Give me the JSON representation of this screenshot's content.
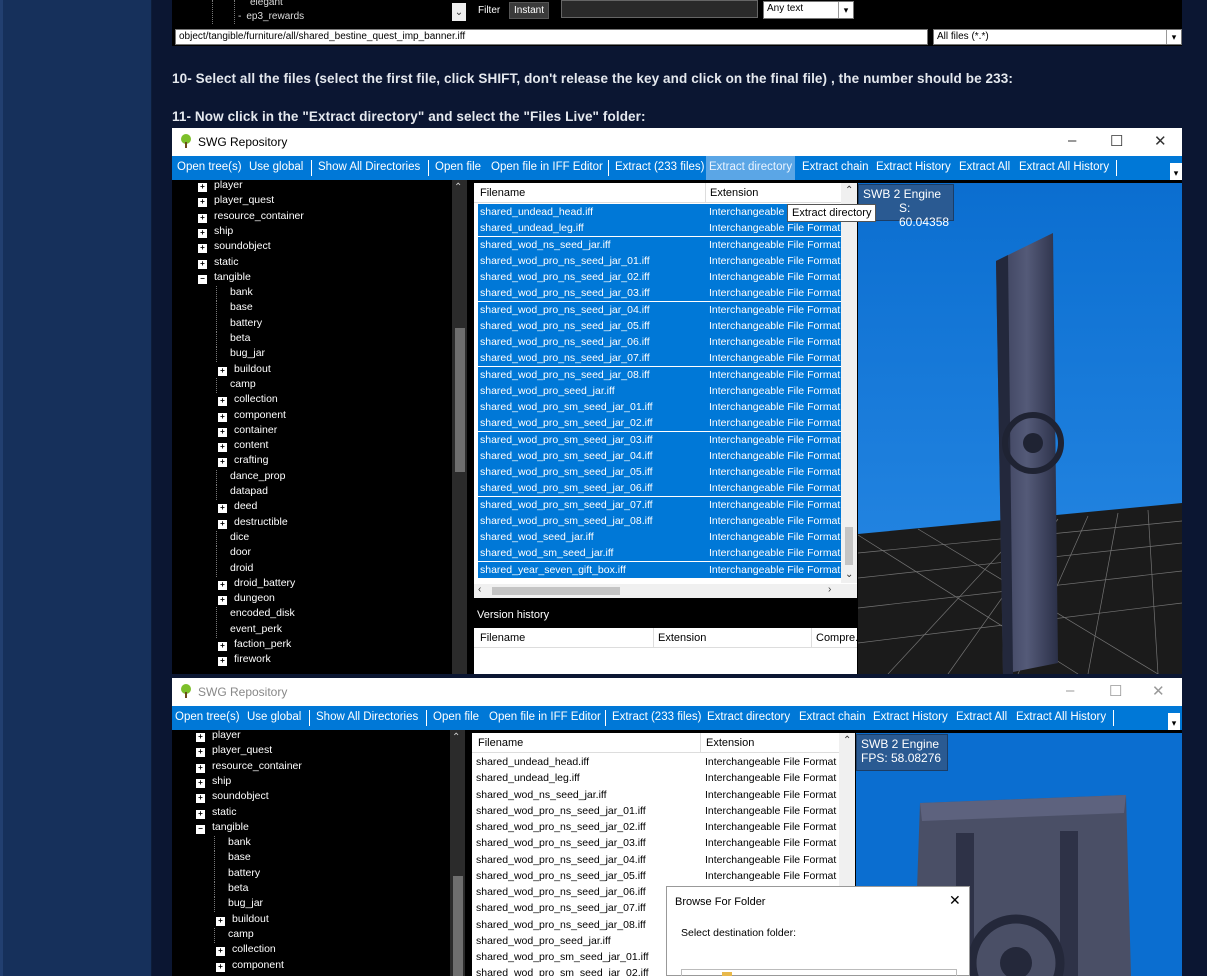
{
  "strip": {
    "tree_rows": [
      "elegant",
      "ep3_rewards"
    ],
    "filter_label": "Filter",
    "instant_button": "Instant",
    "any_text": "Any text",
    "path": "object/tangible/furniture/all/shared_bestine_quest_imp_banner.iff",
    "file_type": "All files (*.*)"
  },
  "instructions": {
    "step10": "10- Select all the files (select the first file, click SHIFT, don't release the key and click on the final file) , the number should be 233:",
    "step11": "11- Now click in the \"Extract directory\" and select the \"Files Live\" folder:"
  },
  "window": {
    "title": "SWG Repository",
    "minimize": "–",
    "maximize": "☐",
    "close": "✕"
  },
  "menu": {
    "open_tree": "Open tree(s)",
    "use_global": "Use global",
    "show_all_dirs": "Show All Directories",
    "open_file": "Open file",
    "open_file_iff": "Open file in IFF Editor",
    "extract": "Extract (233 files)",
    "extract_dir": "Extract directory",
    "extract_chain": "Extract chain",
    "extract_history": "Extract History",
    "extract_all": "Extract All",
    "extract_all_history": "Extract All History",
    "dropdown": "▾"
  },
  "tree1": [
    {
      "label": "player",
      "exp": "+"
    },
    {
      "label": "player_quest",
      "exp": "+"
    },
    {
      "label": "resource_container",
      "exp": "+"
    },
    {
      "label": "ship",
      "exp": "+"
    },
    {
      "label": "soundobject",
      "exp": "+"
    },
    {
      "label": "static",
      "exp": "+"
    },
    {
      "label": "tangible",
      "exp": "−"
    },
    {
      "label": "bank",
      "exp": ""
    },
    {
      "label": "base",
      "exp": ""
    },
    {
      "label": "battery",
      "exp": ""
    },
    {
      "label": "beta",
      "exp": ""
    },
    {
      "label": "bug_jar",
      "exp": ""
    },
    {
      "label": "buildout",
      "exp": "+"
    },
    {
      "label": "camp",
      "exp": ""
    },
    {
      "label": "collection",
      "exp": "+"
    },
    {
      "label": "component",
      "exp": "+"
    },
    {
      "label": "container",
      "exp": "+"
    },
    {
      "label": "content",
      "exp": "+"
    },
    {
      "label": "crafting",
      "exp": "+"
    },
    {
      "label": "dance_prop",
      "exp": ""
    },
    {
      "label": "datapad",
      "exp": ""
    },
    {
      "label": "deed",
      "exp": "+"
    },
    {
      "label": "destructible",
      "exp": "+"
    },
    {
      "label": "dice",
      "exp": ""
    },
    {
      "label": "door",
      "exp": ""
    },
    {
      "label": "droid",
      "exp": ""
    },
    {
      "label": "droid_battery",
      "exp": "+"
    },
    {
      "label": "dungeon",
      "exp": "+"
    },
    {
      "label": "encoded_disk",
      "exp": ""
    },
    {
      "label": "event_perk",
      "exp": ""
    },
    {
      "label": "faction_perk",
      "exp": "+"
    },
    {
      "label": "firework",
      "exp": "+"
    }
  ],
  "tree2": [
    {
      "label": "player",
      "exp": "+"
    },
    {
      "label": "player_quest",
      "exp": "+"
    },
    {
      "label": "resource_container",
      "exp": "+"
    },
    {
      "label": "ship",
      "exp": "+"
    },
    {
      "label": "soundobject",
      "exp": "+"
    },
    {
      "label": "static",
      "exp": "+"
    },
    {
      "label": "tangible",
      "exp": "−"
    },
    {
      "label": "bank",
      "exp": ""
    },
    {
      "label": "base",
      "exp": ""
    },
    {
      "label": "battery",
      "exp": ""
    },
    {
      "label": "beta",
      "exp": ""
    },
    {
      "label": "bug_jar",
      "exp": ""
    },
    {
      "label": "buildout",
      "exp": "+"
    },
    {
      "label": "camp",
      "exp": ""
    },
    {
      "label": "collection",
      "exp": "+"
    },
    {
      "label": "component",
      "exp": "+"
    }
  ],
  "columns": {
    "filename": "Filename",
    "extension": "Extension",
    "compression": "Compre..."
  },
  "ext_text": "Interchangeable File Format (",
  "ext_short": "Interchangeable",
  "files1": [
    "shared_undead_head.iff",
    "shared_undead_leg.iff",
    "shared_wod_ns_seed_jar.iff",
    "shared_wod_pro_ns_seed_jar_01.iff",
    "shared_wod_pro_ns_seed_jar_02.iff",
    "shared_wod_pro_ns_seed_jar_03.iff",
    "shared_wod_pro_ns_seed_jar_04.iff",
    "shared_wod_pro_ns_seed_jar_05.iff",
    "shared_wod_pro_ns_seed_jar_06.iff",
    "shared_wod_pro_ns_seed_jar_07.iff",
    "shared_wod_pro_ns_seed_jar_08.iff",
    "shared_wod_pro_seed_jar.iff",
    "shared_wod_pro_sm_seed_jar_01.iff",
    "shared_wod_pro_sm_seed_jar_02.iff",
    "shared_wod_pro_sm_seed_jar_03.iff",
    "shared_wod_pro_sm_seed_jar_04.iff",
    "shared_wod_pro_sm_seed_jar_05.iff",
    "shared_wod_pro_sm_seed_jar_06.iff",
    "shared_wod_pro_sm_seed_jar_07.iff",
    "shared_wod_pro_sm_seed_jar_08.iff",
    "shared_wod_seed_jar.iff",
    "shared_wod_sm_seed_jar.iff",
    "shared_year_seven_gift_box.iff"
  ],
  "files2": [
    "shared_undead_head.iff",
    "shared_undead_leg.iff",
    "shared_wod_ns_seed_jar.iff",
    "shared_wod_pro_ns_seed_jar_01.iff",
    "shared_wod_pro_ns_seed_jar_02.iff",
    "shared_wod_pro_ns_seed_jar_03.iff",
    "shared_wod_pro_ns_seed_jar_04.iff",
    "shared_wod_pro_ns_seed_jar_05.iff",
    "shared_wod_pro_ns_seed_jar_06.iff",
    "shared_wod_pro_ns_seed_jar_07.iff",
    "shared_wod_pro_ns_seed_jar_08.iff",
    "shared_wod_pro_seed_jar.iff",
    "shared_wod_pro_sm_seed_jar_01.iff",
    "shared_wod_pro_sm_seed_jar_02.iff"
  ],
  "tooltip": "Extract directory",
  "version_history": "Version history",
  "engine": {
    "label": "SWB 2 Engine",
    "fps1_partial": "S: 60.04358",
    "fps2": "FPS: 58.08276"
  },
  "dialog": {
    "title": "Browse For Folder",
    "prompt": "Select destination folder:",
    "close": "✕"
  },
  "colors": {
    "accent": "#0078d7",
    "background": "#0b1632",
    "sidebar": "#16305b"
  }
}
